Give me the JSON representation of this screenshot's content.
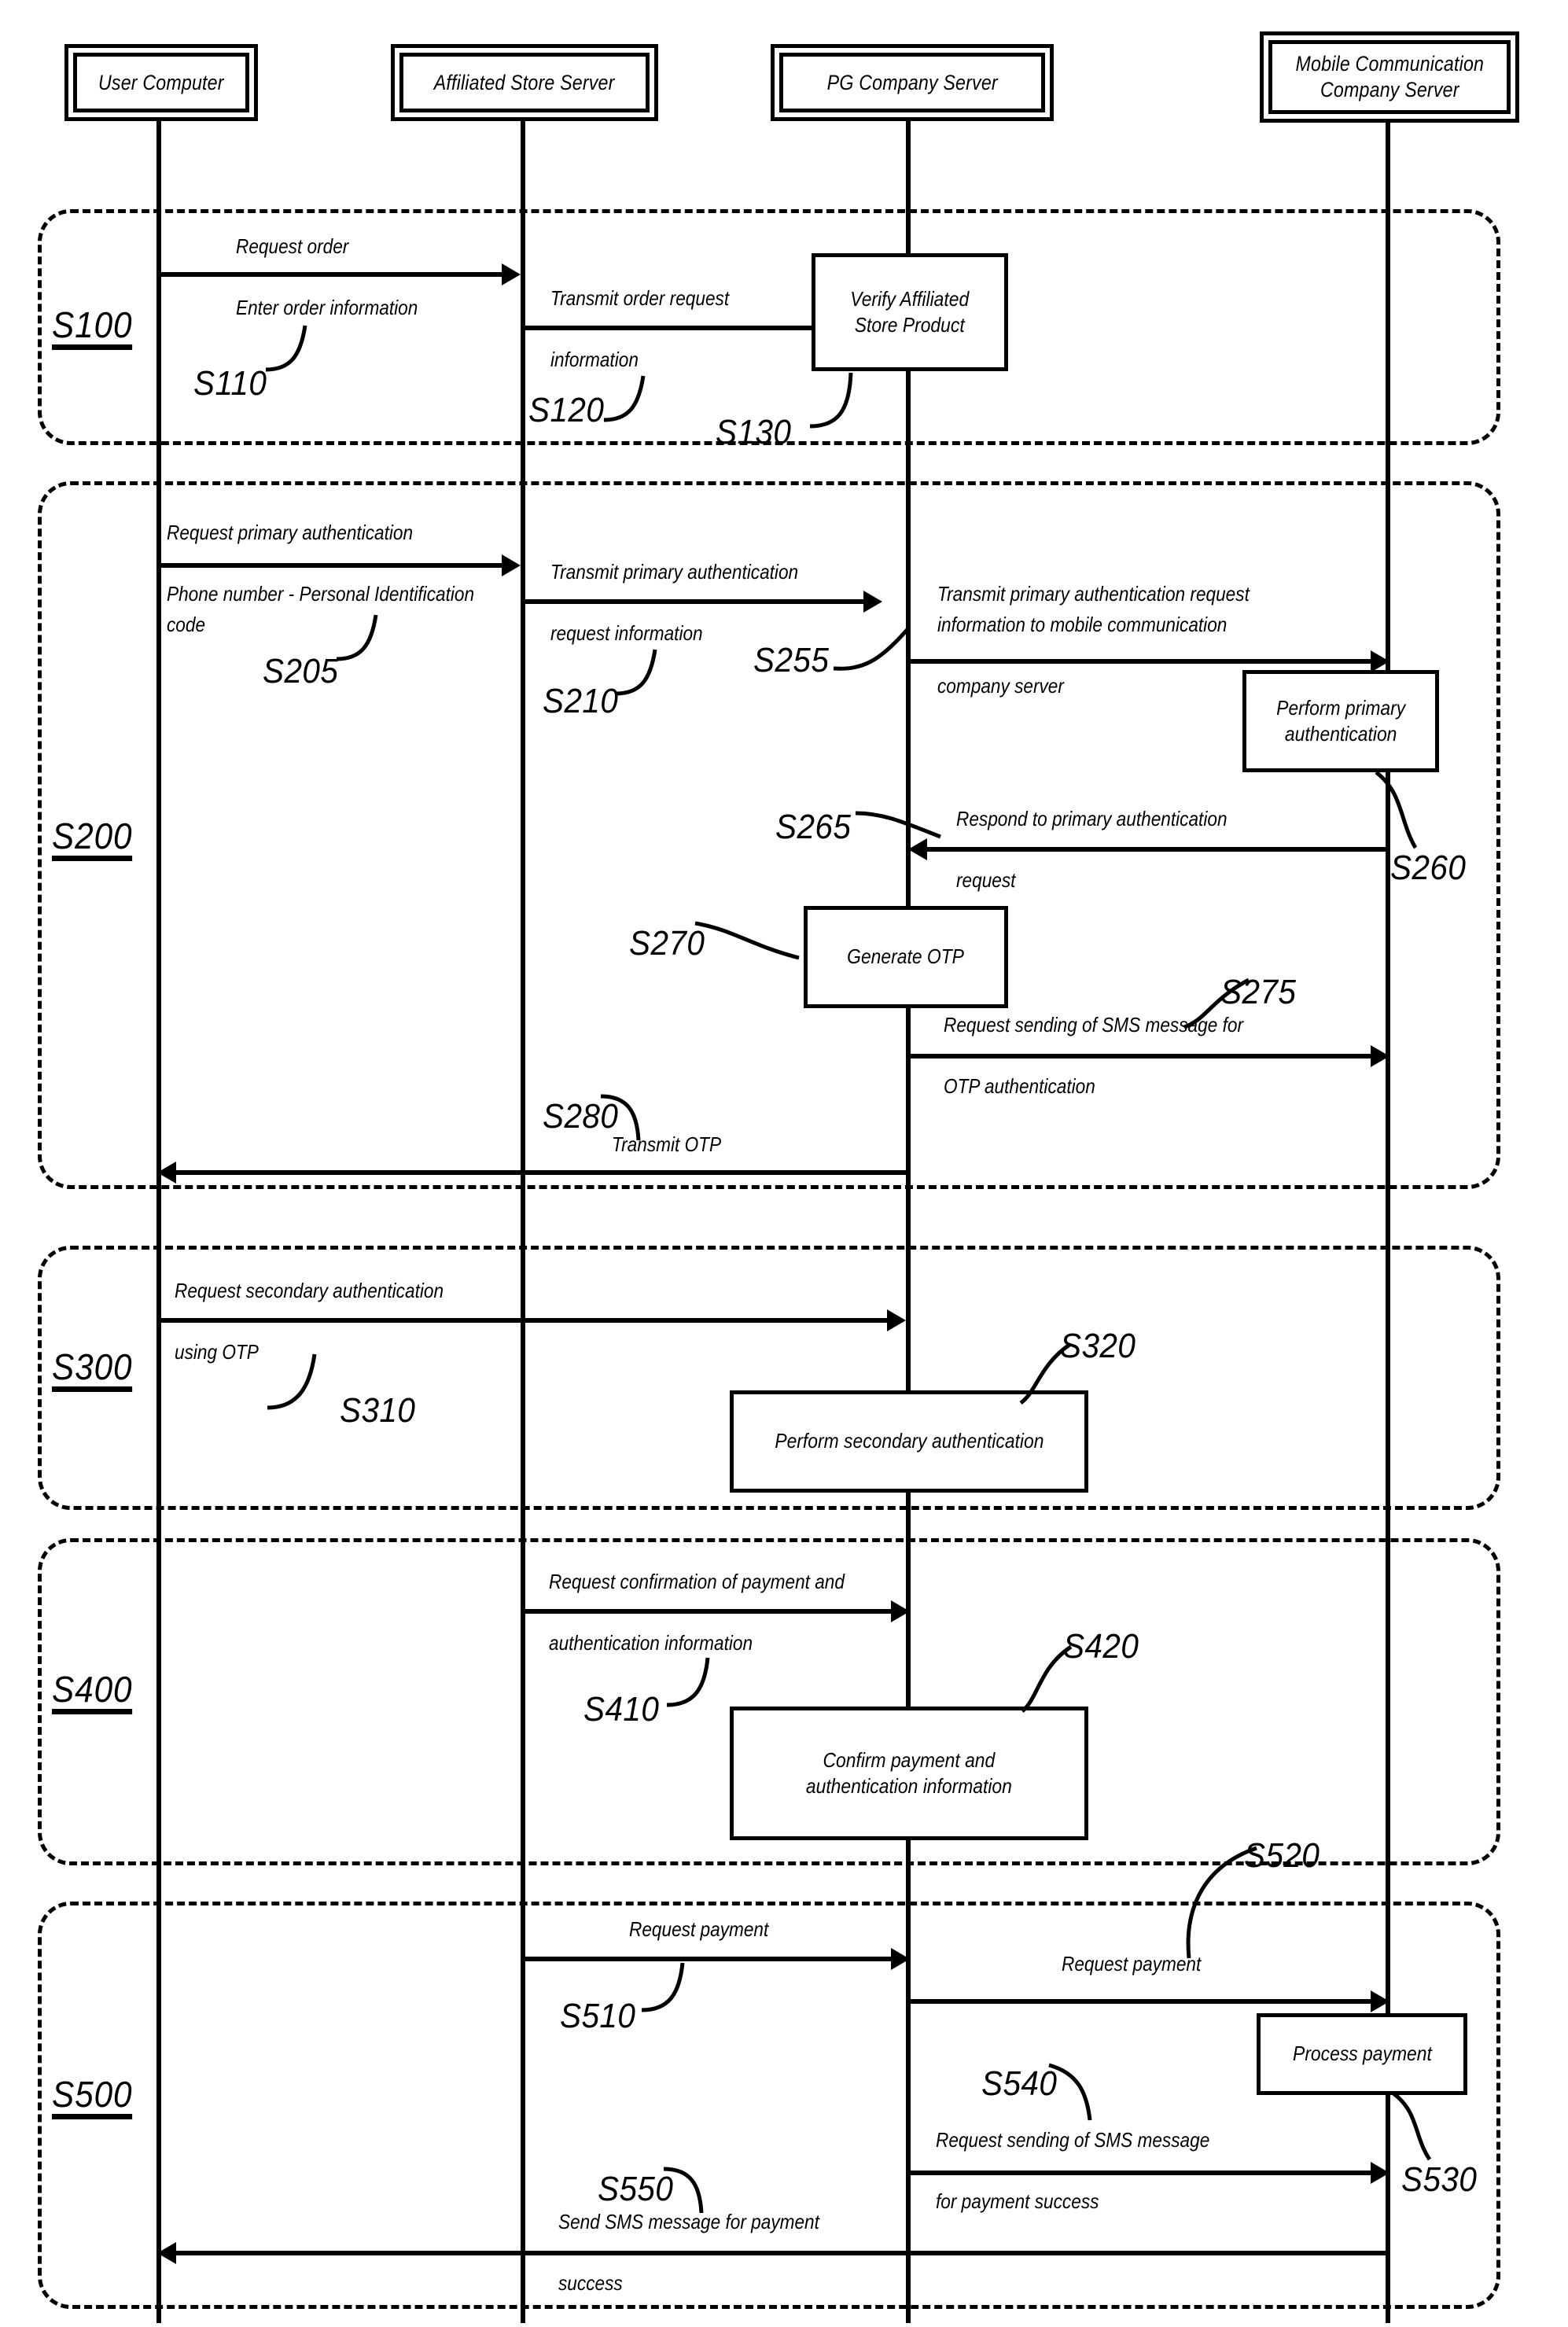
{
  "diagram": {
    "type": "sequence-diagram",
    "title": "Payment and OTP authentication sequence"
  },
  "actors": [
    {
      "id": "user-computer",
      "label": "User Computer"
    },
    {
      "id": "affiliated-store-server",
      "label": "Affiliated Store Server"
    },
    {
      "id": "pg-company-server",
      "label": "PG Company Server"
    },
    {
      "id": "mobile-communication-company-server",
      "label": "Mobile Communication\nCompany Server"
    }
  ],
  "phases": [
    {
      "id": "s100",
      "code": "S100"
    },
    {
      "id": "s200",
      "code": "S200"
    },
    {
      "id": "s300",
      "code": "S300"
    },
    {
      "id": "s400",
      "code": "S400"
    },
    {
      "id": "s500",
      "code": "S500"
    }
  ],
  "messages": [
    {
      "id": "s110",
      "code": "S110",
      "label": "Request order\n\nEnter order information",
      "from": "user-computer",
      "to": "affiliated-store-server",
      "direction": "right"
    },
    {
      "id": "s120",
      "code": "S120",
      "label": "Transmit order request\n\ninformation",
      "from": "affiliated-store-server",
      "to": "pg-company-server",
      "direction": "right"
    },
    {
      "id": "s205",
      "code": "S205",
      "label": "Request primary authentication\n\nPhone number - Personal Identification\ncode",
      "from": "user-computer",
      "to": "affiliated-store-server",
      "direction": "right"
    },
    {
      "id": "s210",
      "code": "S210",
      "label": "Transmit primary authentication\n\nrequest information",
      "from": "affiliated-store-server",
      "to": "pg-company-server",
      "direction": "right"
    },
    {
      "id": "s255",
      "code": "S255",
      "label": "Transmit primary authentication request\ninformation to mobile communication\n\ncompany server",
      "from": "pg-company-server",
      "to": "mobile-communication-company-server",
      "direction": "right"
    },
    {
      "id": "s265",
      "code": "S265",
      "label": "Respond to primary authentication\n\nrequest",
      "from": "mobile-communication-company-server",
      "to": "pg-company-server",
      "direction": "left"
    },
    {
      "id": "s275",
      "code": "S275",
      "label": "Request sending of SMS message for\n\nOTP authentication",
      "from": "pg-company-server",
      "to": "mobile-communication-company-server",
      "direction": "right"
    },
    {
      "id": "s280",
      "code": "S280",
      "label": "Transmit OTP",
      "from": "pg-company-server",
      "to": "user-computer",
      "direction": "left"
    },
    {
      "id": "s310",
      "code": "S310",
      "label": "Request secondary authentication\n\nusing OTP",
      "from": "user-computer",
      "to": "pg-company-server",
      "direction": "right"
    },
    {
      "id": "s410",
      "code": "S410",
      "label": "Request confirmation of payment and\n\nauthentication information",
      "from": "affiliated-store-server",
      "to": "pg-company-server",
      "direction": "right"
    },
    {
      "id": "s510",
      "code": "S510",
      "label": "Request payment",
      "from": "affiliated-store-server",
      "to": "pg-company-server",
      "direction": "right"
    },
    {
      "id": "s520",
      "code": "S520",
      "label": "Request payment",
      "from": "pg-company-server",
      "to": "mobile-communication-company-server",
      "direction": "right"
    },
    {
      "id": "s540",
      "code": "S540",
      "label": "Request sending of SMS message\n\nfor payment success",
      "from": "pg-company-server",
      "to": "mobile-communication-company-server",
      "direction": "right"
    },
    {
      "id": "s550",
      "code": "S550",
      "label": "Send SMS message for payment\n\nsuccess",
      "from": "mobile-communication-company-server",
      "to": "user-computer",
      "direction": "left"
    }
  ],
  "processes": [
    {
      "id": "s130",
      "code": "S130",
      "label": "Verify Affiliated\nStore Product",
      "on": "pg-company-server"
    },
    {
      "id": "s260",
      "code": "S260",
      "label": "Perform primary\nauthentication",
      "on": "mobile-communication-company-server"
    },
    {
      "id": "s270",
      "code": "S270",
      "label": "Generate OTP",
      "on": "pg-company-server"
    },
    {
      "id": "s320",
      "code": "S320",
      "label": "Perform secondary authentication",
      "on": "pg-company-server"
    },
    {
      "id": "s420",
      "code": "S420",
      "label": "Confirm payment and\nauthentication information",
      "on": "pg-company-server"
    },
    {
      "id": "s530",
      "code": "S530",
      "label": "Process payment",
      "on": "mobile-communication-company-server"
    }
  ]
}
